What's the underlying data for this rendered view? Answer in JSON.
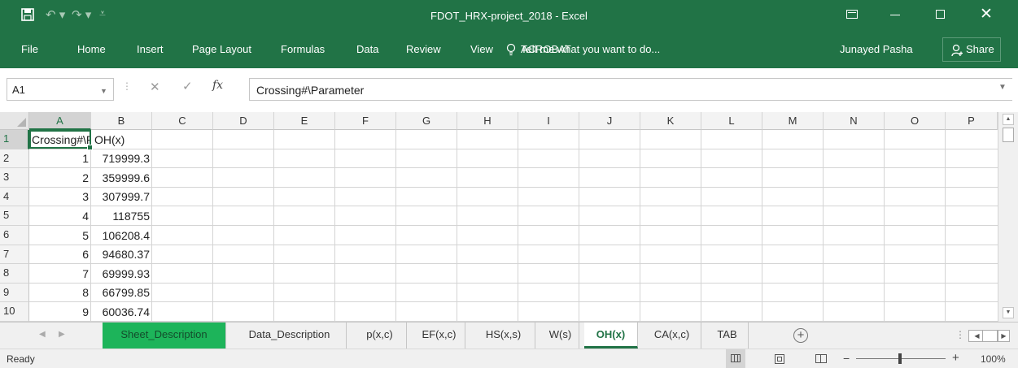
{
  "window": {
    "title": "FDOT_HRX-project_2018 - Excel"
  },
  "ribbon": {
    "tabs": [
      "File",
      "Home",
      "Insert",
      "Page Layout",
      "Formulas",
      "Data",
      "Review",
      "View",
      "ACROBAT"
    ],
    "tell_me": "Tell me what you want to do...",
    "user": "Junayed Pasha",
    "share": "Share"
  },
  "formula_bar": {
    "name_box": "A1",
    "fx": "fx",
    "formula": "Crossing#\\Parameter"
  },
  "columns": [
    "A",
    "B",
    "C",
    "D",
    "E",
    "F",
    "G",
    "H",
    "I",
    "J",
    "K",
    "L",
    "M",
    "N",
    "O",
    "P"
  ],
  "rows": [
    {
      "num": "1",
      "a": "Crossing#\\Parameter",
      "b": "OH(x)"
    },
    {
      "num": "2",
      "a": "1",
      "b": "719999.3"
    },
    {
      "num": "3",
      "a": "2",
      "b": "359999.6"
    },
    {
      "num": "4",
      "a": "3",
      "b": "307999.7"
    },
    {
      "num": "5",
      "a": "4",
      "b": "118755"
    },
    {
      "num": "6",
      "a": "5",
      "b": "106208.4"
    },
    {
      "num": "7",
      "a": "6",
      "b": "94680.37"
    },
    {
      "num": "8",
      "a": "7",
      "b": "69999.93"
    },
    {
      "num": "9",
      "a": "8",
      "b": "66799.85"
    },
    {
      "num": "10",
      "a": "9",
      "b": "60036.74"
    }
  ],
  "sheets": [
    "Sheet_Description",
    "Data_Description",
    "p(x,c)",
    "EF(x,c)",
    "HS(x,s)",
    "W(s)",
    "OH(x)",
    "CA(x,c)",
    "TAB"
  ],
  "active_sheet": "OH(x)",
  "status": {
    "ready": "Ready",
    "zoom": "100%"
  },
  "colors": {
    "excel_green": "#217346",
    "highlight_tab": "#1db45a"
  }
}
